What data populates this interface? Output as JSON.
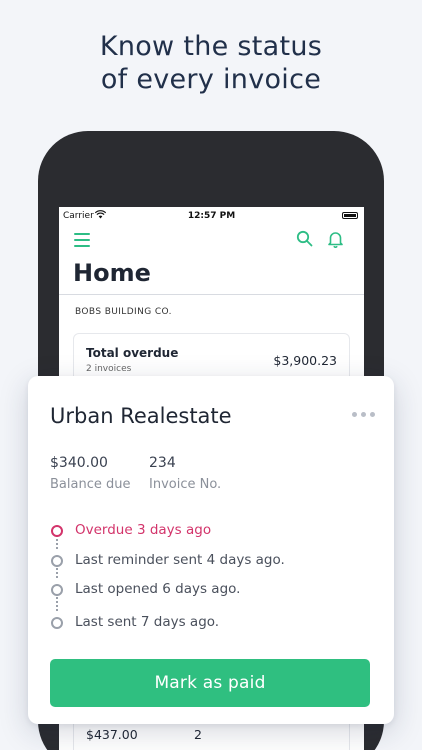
{
  "headline": {
    "line1": "Know the status",
    "line2": "of every invoice"
  },
  "status_bar": {
    "carrier": "Carrier",
    "time": "12:57 PM"
  },
  "app": {
    "title": "Home",
    "company": "BOBS BUILDING CO.",
    "accent_color": "#2dbd85",
    "icons": [
      "hamburger-menu-icon",
      "search-icon",
      "bell-icon"
    ],
    "overdue_card": {
      "title": "Total overdue",
      "subtitle": "2 invoices",
      "amount": "$3,900.23"
    },
    "bottom_card": {
      "amount": "$437.00",
      "invoice_no": "2"
    }
  },
  "invoice": {
    "client": "Urban Realestate",
    "balance_value": "$340.00",
    "balance_label": "Balance due",
    "invoice_no_value": "234",
    "invoice_no_label": "Invoice No.",
    "timeline": [
      {
        "text": "Overdue 3 days ago",
        "status": "overdue",
        "color": "#d3346b"
      },
      {
        "text": "Last reminder sent 4 days ago.",
        "status": "normal"
      },
      {
        "text": "Last opened 6 days ago.",
        "status": "normal"
      },
      {
        "text": "Last sent 7 days ago.",
        "status": "normal"
      }
    ],
    "action_label": "Mark as paid",
    "action_color": "#2fbf80"
  }
}
